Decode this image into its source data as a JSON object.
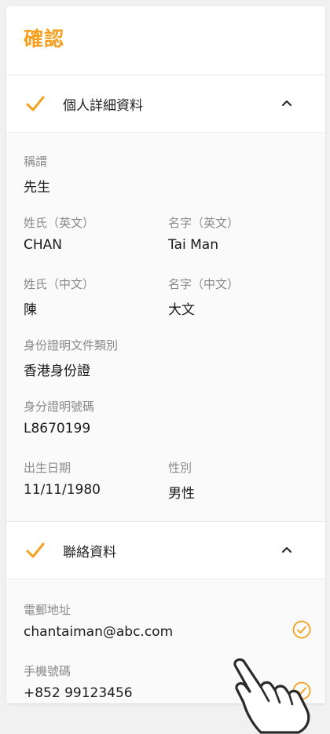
{
  "page": {
    "title": "確認"
  },
  "colors": {
    "accent": "#f5a020",
    "label": "#8a8a8a",
    "text": "#1a1a1a"
  },
  "sections": {
    "personal": {
      "title": "個人詳細資料",
      "icon_done": "check-icon",
      "icon_toggle": "chevron-up-icon",
      "fields": {
        "salutation": {
          "label": "稱謂",
          "value": "先生"
        },
        "surname_en": {
          "label": "姓氏（英文）",
          "value": "CHAN"
        },
        "given_en": {
          "label": "名字（英文）",
          "value": "Tai Man"
        },
        "surname_zh": {
          "label": "姓氏（中文）",
          "value": "陳"
        },
        "given_zh": {
          "label": "名字（中文）",
          "value": "大文"
        },
        "id_type": {
          "label": "身份證明文件類別",
          "value": "香港身份證"
        },
        "id_number": {
          "label": "身分證明號碼",
          "value": "L8670199"
        },
        "dob": {
          "label": "出生日期",
          "value": "11/11/1980"
        },
        "gender": {
          "label": "性別",
          "value": "男性"
        }
      }
    },
    "contact": {
      "title": "聯絡資料",
      "icon_done": "check-icon",
      "icon_toggle": "chevron-up-icon",
      "fields": {
        "email": {
          "label": "電郵地址",
          "value": "chantaiman@abc.com",
          "icon": "check-circle-icon"
        },
        "mobile": {
          "label": "手機號碼",
          "value": "+852 99123456",
          "icon": "check-circle-icon"
        }
      }
    }
  },
  "overlay": {
    "icon": "tap-hand-icon"
  }
}
